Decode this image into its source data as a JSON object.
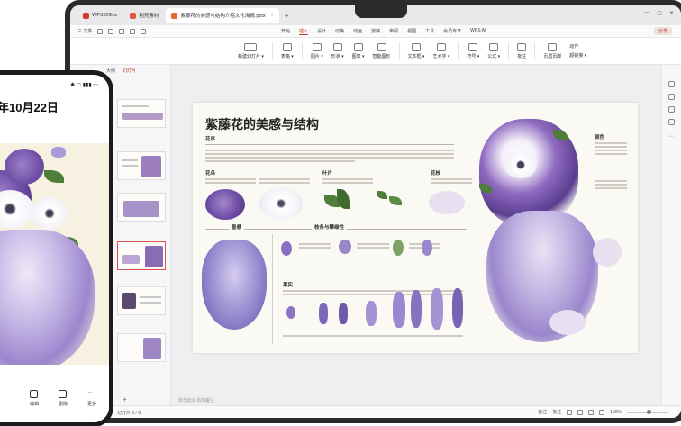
{
  "browser_tabs": [
    {
      "label": "WPS Office",
      "color": "#d33a2c"
    },
    {
      "label": "稻壳素材",
      "color": "#e0573b"
    },
    {
      "label": "紫藤花的美感与结构介绍文化海报.pptx",
      "color": "#e26a2c",
      "active": true
    }
  ],
  "menu": {
    "left_items": [
      "三 文件"
    ],
    "tabs": [
      "开始",
      "插入",
      "设计",
      "切换",
      "动画",
      "放映",
      "审阅",
      "视图",
      "工具",
      "会员专享",
      "WPS AI"
    ],
    "active_tab": "插入",
    "share_label": "分享"
  },
  "ribbon": {
    "groups": [
      {
        "label": "新建幻灯片 ▾"
      },
      {
        "label": "表格 ▾"
      },
      {
        "label": "图片 ▾"
      },
      {
        "label": "形状 ▾"
      },
      {
        "label": "图表 ▾"
      },
      {
        "label": "智能图形"
      },
      {
        "label": "文本框 ▾"
      },
      {
        "label": "艺术字 ▾"
      },
      {
        "label": "符号 ▾"
      },
      {
        "label": "公式 ▾"
      },
      {
        "label": "批注"
      },
      {
        "label": "页眉页脚"
      }
    ],
    "side_items": [
      "动作",
      "超链接 ▾"
    ]
  },
  "thumbs_panel": {
    "tabs": [
      "大纲",
      "幻灯片"
    ],
    "active": "幻灯片",
    "add_label": "+"
  },
  "notes_placeholder": "单击此处添加备注",
  "statusbar": {
    "left": "幻灯片 5 / 8",
    "view_label": "备注",
    "comment_label": "批注",
    "zoom": "100%"
  },
  "slide": {
    "title": "紫藤花的美感与结构",
    "sections": {
      "flower_order": "花序",
      "petal": "花朵",
      "leaf": "叶片",
      "stem": "花枝",
      "color": "颜色",
      "cluster": "果实",
      "texture": "枝条与攀缘性",
      "fall": "垂悬"
    },
    "accent": "#7a5ca8"
  },
  "phone": {
    "date": "年10月22日",
    "subtitle": "",
    "buttons": [
      {
        "label": "编辑",
        "icon": "edit-icon"
      },
      {
        "label": "删除",
        "icon": "delete-icon"
      },
      {
        "label": "更多",
        "icon": "more-icon"
      }
    ]
  }
}
